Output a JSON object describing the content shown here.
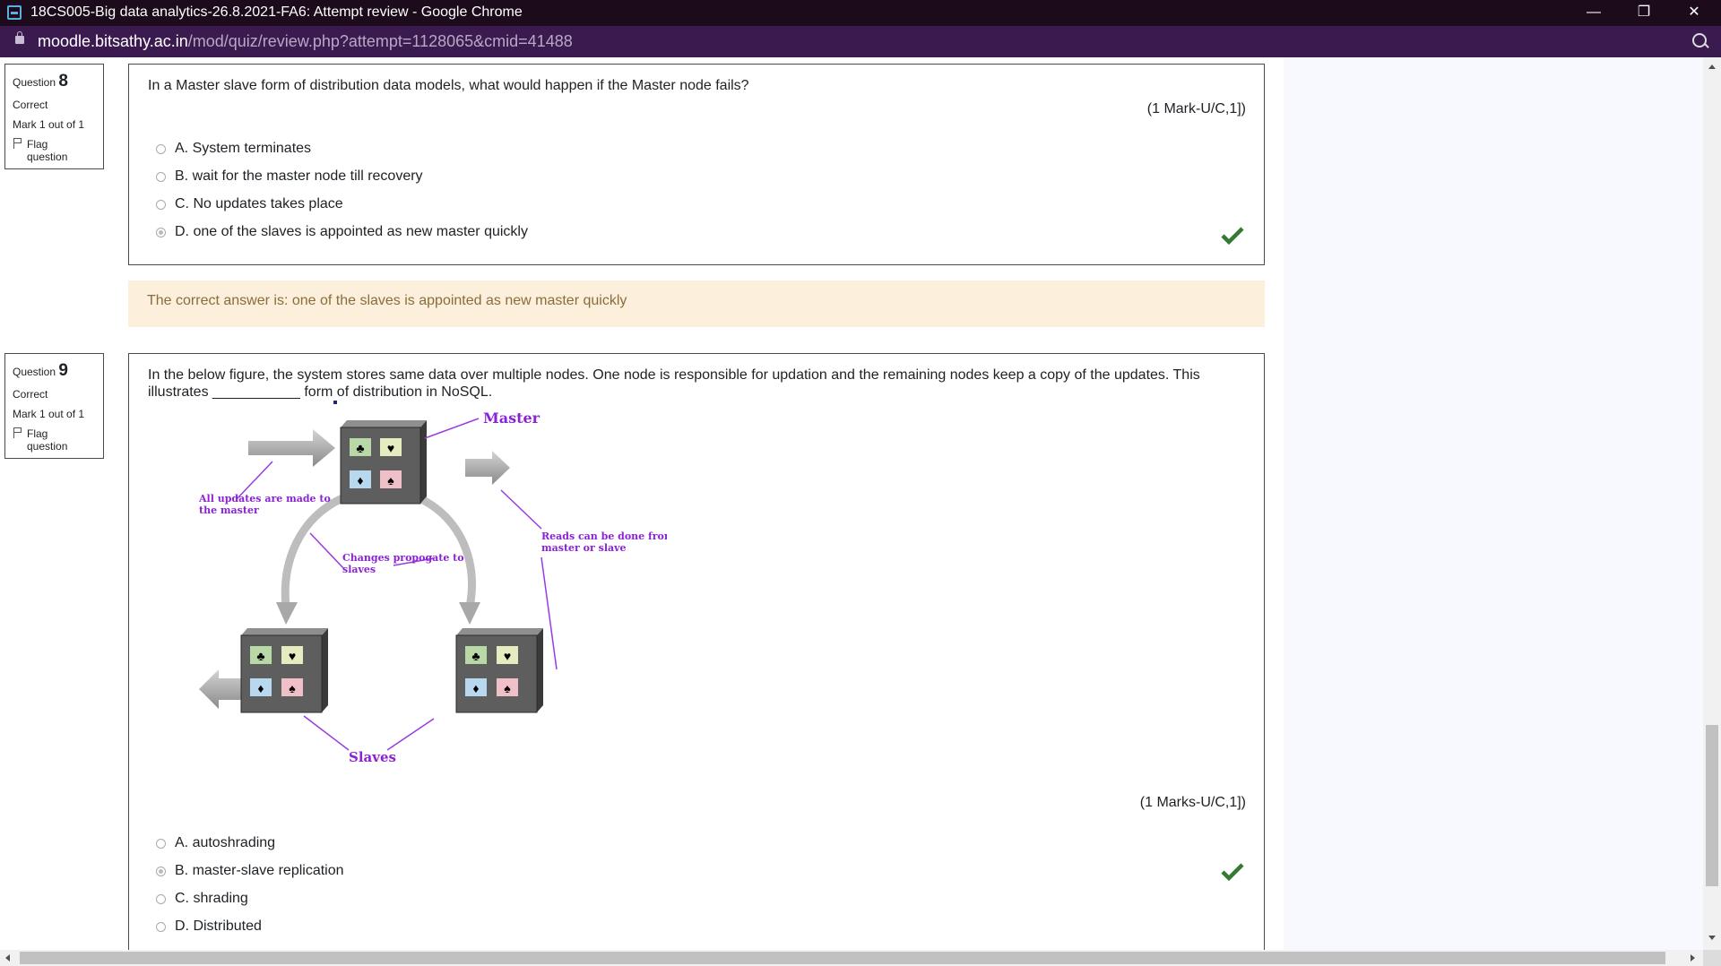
{
  "window": {
    "title": "18CS005-Big data analytics-26.8.2021-FA6: Attempt review - Google Chrome",
    "minimize_glyph": "—",
    "restore_glyph": "❐",
    "close_glyph": "✕"
  },
  "address": {
    "host": "moodle.bitsathy.ac.in",
    "path": "/mod/quiz/review.php?attempt=1128065&cmid=41488"
  },
  "questions": [
    {
      "label": "Question",
      "number": "8",
      "state": "Correct",
      "mark": "Mark 1 out of 1",
      "flag": "Flag question",
      "text": "In a Master slave form of distribution data models, what would happen if the Master node fails?",
      "marks_info": "(1 Mark-U/C,1])",
      "options": [
        {
          "text": "A. System terminates",
          "selected": false
        },
        {
          "text": "B. wait for the master node till recovery",
          "selected": false
        },
        {
          "text": "C. No updates takes place",
          "selected": false
        },
        {
          "text": "D. one of the slaves is appointed as new master quickly",
          "selected": true
        }
      ],
      "feedback": "The correct answer is: one of the slaves is appointed as new master quickly"
    },
    {
      "label": "Question",
      "number": "9",
      "state": "Correct",
      "mark": "Mark 1 out of 1",
      "flag": "Flag question",
      "text_line1": "In the below figure, the system stores same data over multiple nodes. One node is responsible for updation and the remaining nodes keep a copy of the updates. This",
      "text_line2": "illustrates ___________ form of distribution in NoSQL.",
      "diagram": {
        "master": "Master",
        "updates_line1": "All updates are made to",
        "updates_line2": "the master",
        "changes_line1": "Changes propogate to",
        "changes_line2": "slaves",
        "reads_line1": "Reads can be done from",
        "reads_line2": "master or slave",
        "slaves": "Slaves",
        "suit_club": "♣",
        "suit_heart": "♥",
        "suit_diamond": "♦",
        "suit_spade": "♠"
      },
      "marks_info": "(1 Marks-U/C,1])",
      "options": [
        {
          "text": "A. autoshrading",
          "selected": false
        },
        {
          "text": "B. master-slave replication",
          "selected": true
        },
        {
          "text": "C. shrading",
          "selected": false
        },
        {
          "text": "D. Distributed",
          "selected": false
        }
      ]
    }
  ],
  "colors": {
    "titlebar": "#1c0b1a",
    "addressbar": "#3b1b4f",
    "feedback_bg": "#fcefdc",
    "feedback_text": "#8a6d3b",
    "check": "#357a32",
    "diagram_label": "#8b22d6"
  }
}
